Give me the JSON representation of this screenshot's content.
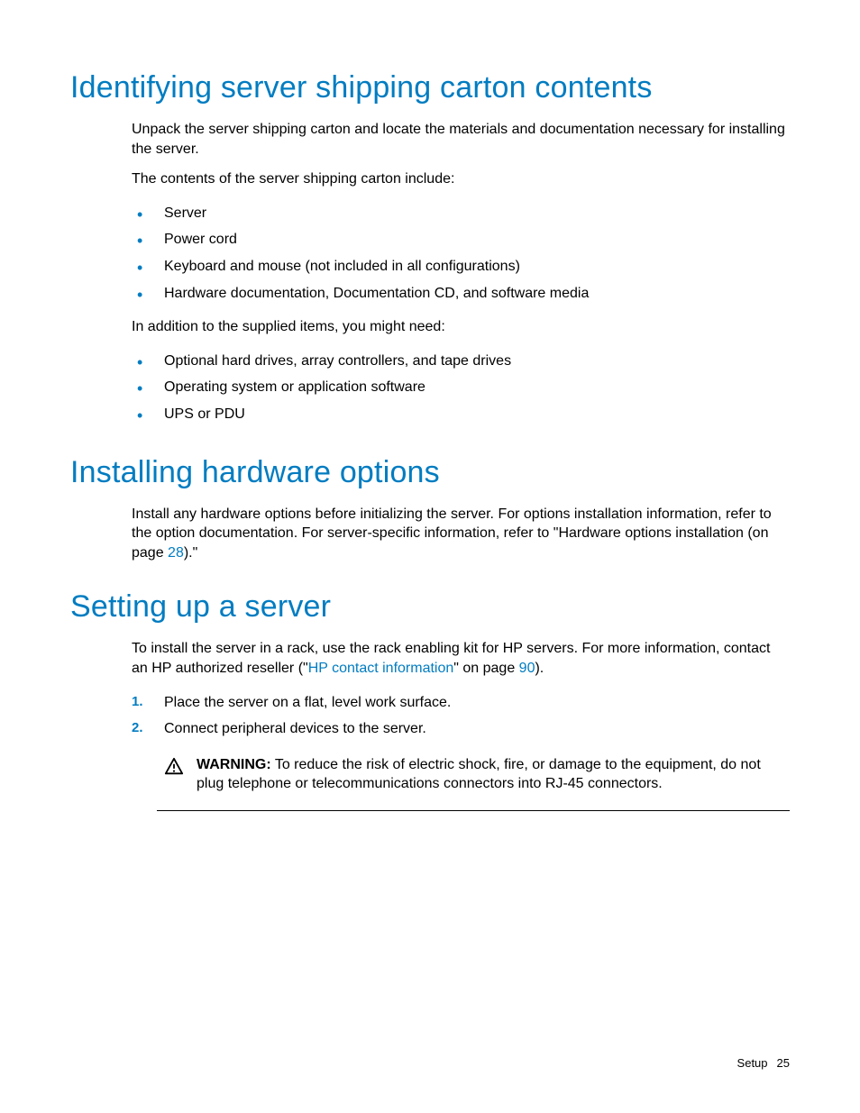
{
  "h1_1": "Identifying server shipping carton contents",
  "p1": "Unpack the server shipping carton and locate the materials and documentation necessary for installing the server.",
  "p2": "The contents of the server shipping carton include:",
  "list1": {
    "i0": "Server",
    "i1": "Power cord",
    "i2": "Keyboard and mouse (not included in all configurations)",
    "i3": "Hardware documentation, Documentation CD, and software media"
  },
  "p3": "In addition to the supplied items, you might need:",
  "list2": {
    "i0": "Optional hard drives, array controllers, and tape drives",
    "i1": "Operating system or application software",
    "i2": "UPS or PDU"
  },
  "h1_2": "Installing hardware options",
  "p4a": "Install any hardware options before initializing the server. For options installation information, refer to the option documentation. For server-specific information, refer to \"Hardware options installation (on page ",
  "p4link": "28",
  "p4b": ").\"",
  "h1_3": "Setting up a server",
  "p5a": "To install the server in a rack, use the rack enabling kit for HP servers. For more information, contact an HP authorized reseller (\"",
  "p5link1": "HP contact information",
  "p5b": "\" on page ",
  "p5link2": "90",
  "p5c": ").",
  "steps": {
    "s0": "Place the server on a flat, level work surface.",
    "s1": "Connect peripheral devices to the server."
  },
  "warning": {
    "label": "WARNING:",
    "text": "  To reduce the risk of electric shock, fire, or damage to the equipment, do not plug telephone or telecommunications connectors into RJ-45 connectors."
  },
  "footer": {
    "section": "Setup",
    "page": "25"
  }
}
